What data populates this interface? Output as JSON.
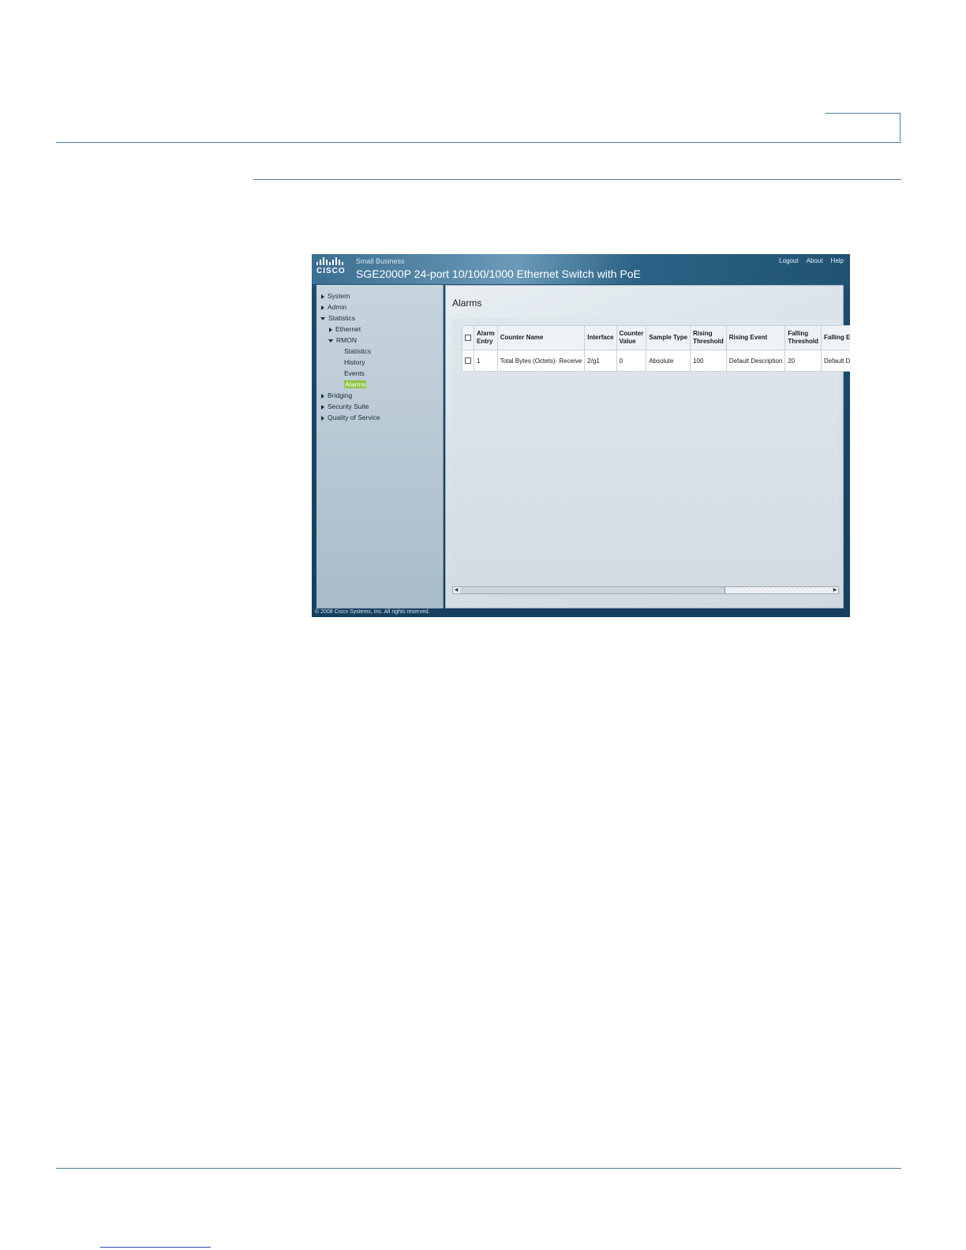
{
  "app": {
    "brand_small": "Small Business",
    "logo_text": "CISCO",
    "product_title": "SGE2000P 24-port 10/100/1000 Ethernet Switch with PoE",
    "links": [
      "Logout",
      "About",
      "Help"
    ]
  },
  "nav": {
    "items": [
      {
        "label": "System"
      },
      {
        "label": "Admin"
      },
      {
        "label": "Statistics"
      },
      {
        "label": "Ethernet"
      },
      {
        "label": "RMON"
      },
      {
        "label": "Statistics"
      },
      {
        "label": "History"
      },
      {
        "label": "Events"
      },
      {
        "label": "Alarms"
      },
      {
        "label": "Bridging"
      },
      {
        "label": "Security Suite"
      },
      {
        "label": "Quality of Service"
      }
    ]
  },
  "page": {
    "title": "Alarms",
    "columns": [
      "Alarm Entry",
      "Counter Name",
      "Interface",
      "Counter Value",
      "Sample Type",
      "Rising Threshold",
      "Rising Event",
      "Falling Threshold",
      "Falling Event"
    ],
    "rows": [
      [
        "1",
        "Total Bytes (Octets)- Receive",
        "2/g1",
        "0",
        "Absolute",
        "100",
        "Default Description",
        "20",
        "Default Description"
      ]
    ]
  },
  "footer": {
    "copyright": "© 2008 Cisco Systems, Inc. All rights reserved."
  }
}
